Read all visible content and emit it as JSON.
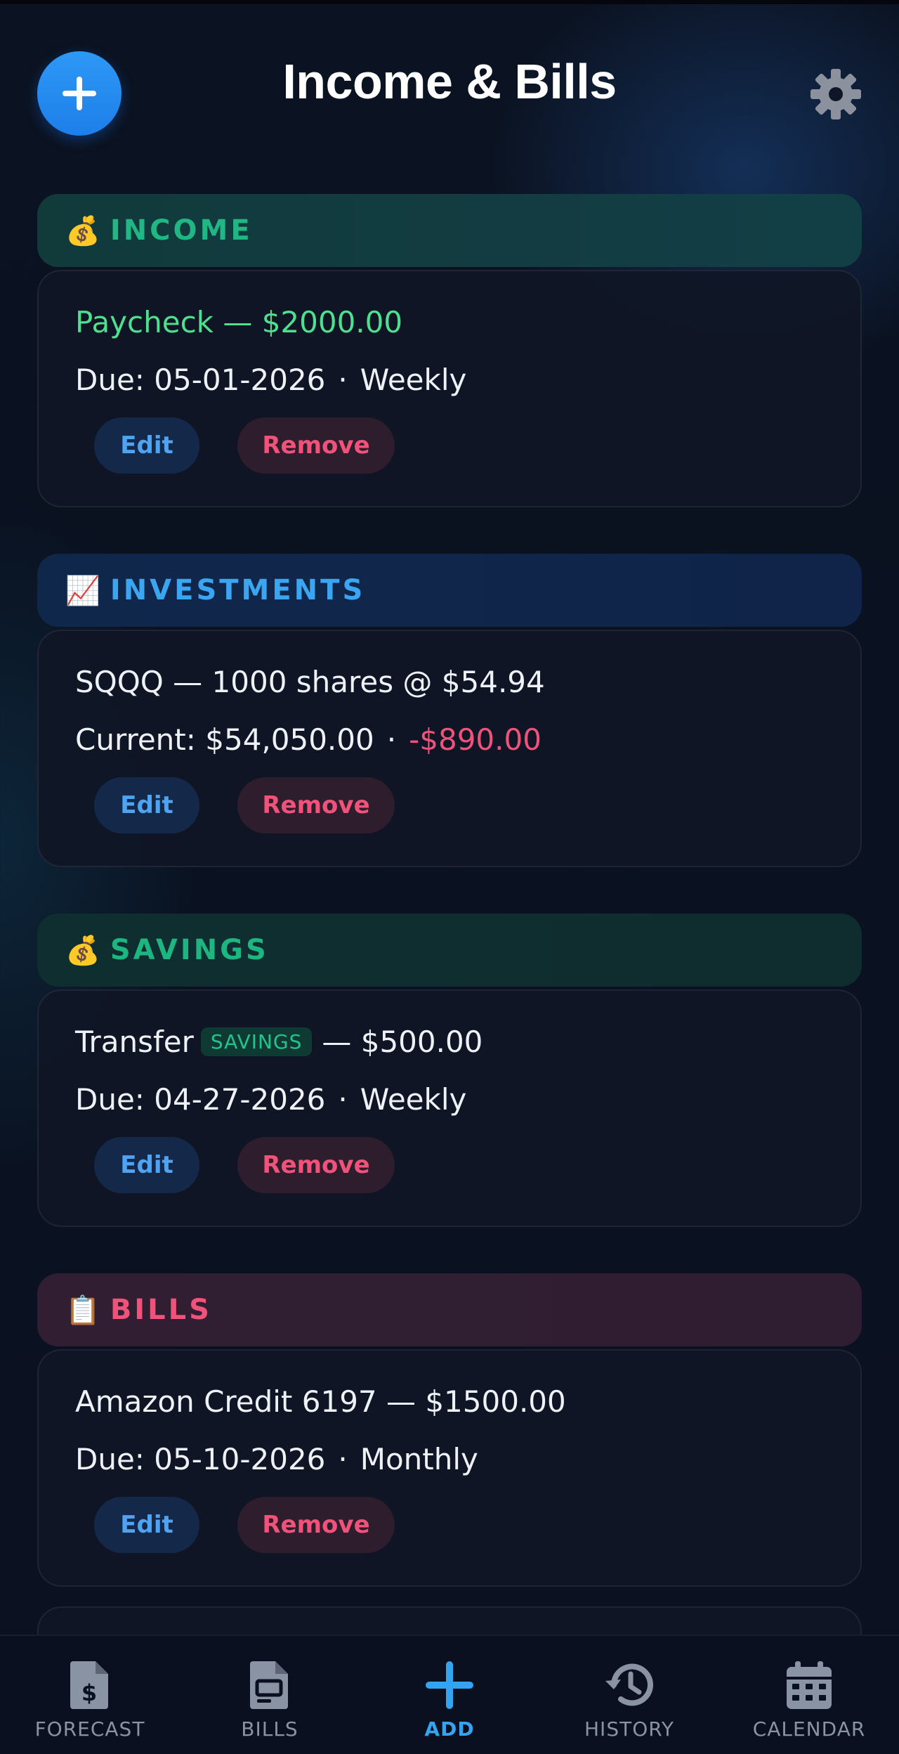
{
  "header": {
    "title": "Income & Bills",
    "add_icon": "plus-icon",
    "settings_icon": "gear-icon"
  },
  "sections": {
    "income": {
      "emoji": "💰",
      "title": "INCOME",
      "item": {
        "name_amount": "Paycheck — $2000.00",
        "due": "Due: 05-01-2026",
        "frequency": "Weekly",
        "edit_label": "Edit",
        "remove_label": "Remove"
      }
    },
    "investments": {
      "emoji": "📈",
      "title": "INVESTMENTS",
      "item": {
        "holding": "SQQQ — 1000 shares @ $54.94",
        "current": "Current: $54,050.00",
        "change": "-$890.00",
        "edit_label": "Edit",
        "remove_label": "Remove"
      }
    },
    "savings": {
      "emoji": "💰",
      "title": "SAVINGS",
      "item": {
        "name": "Transfer",
        "badge": "SAVINGS",
        "amount": "— $500.00",
        "due": "Due: 04-27-2026",
        "frequency": "Weekly",
        "edit_label": "Edit",
        "remove_label": "Remove"
      }
    },
    "bills": {
      "emoji": "📋",
      "title": "BILLS",
      "item": {
        "name_amount": "Amazon Credit 6197 — $1500.00",
        "due": "Due: 05-10-2026",
        "frequency": "Monthly",
        "edit_label": "Edit",
        "remove_label": "Remove"
      }
    }
  },
  "separator": "·",
  "bottom_nav": {
    "items": [
      {
        "label": "FORECAST",
        "icon": "forecast-document-icon"
      },
      {
        "label": "BILLS",
        "icon": "bills-document-icon"
      },
      {
        "label": "ADD",
        "icon": "plus-icon",
        "active": true
      },
      {
        "label": "HISTORY",
        "icon": "history-icon"
      },
      {
        "label": "CALENDAR",
        "icon": "calendar-icon"
      }
    ]
  },
  "colors": {
    "accent_blue": "#2e98f6",
    "income_green": "#4ee08f",
    "loss_red": "#f0527a"
  }
}
